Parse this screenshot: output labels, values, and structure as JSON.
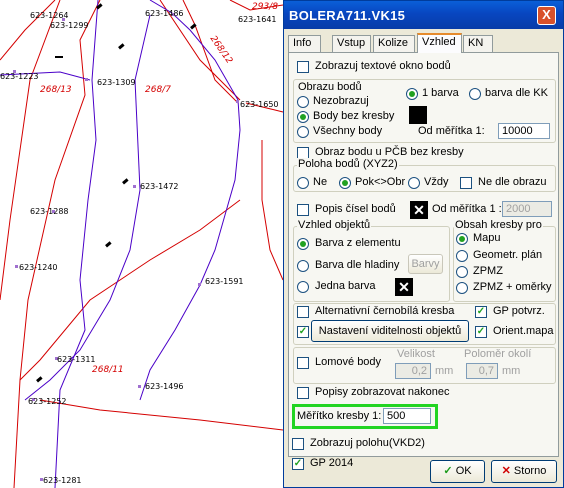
{
  "map": {
    "point_labels": [
      "623-1299",
      "623-1486",
      "623-1641",
      "623-1223",
      "623-1309",
      "623-1650",
      "623-1472",
      "623-1288",
      "623-1240",
      "623-1591",
      "623-1311",
      "623-1252",
      "623-1496",
      "623-1281",
      "623-1264"
    ],
    "parcel_labels": [
      "268/13",
      "268/7",
      "268/12",
      "268/11",
      "293/8"
    ],
    "line_color": "#d40000",
    "route_color": "#4a00c8"
  },
  "dialog": {
    "title": "BOLERA711.VK15",
    "close_glyph": "X",
    "tabs": [
      "Info",
      "Vstup",
      "Kolize",
      "Vzhled",
      "KN"
    ],
    "active_tab": "Vzhled",
    "show_text_window": "Zobrazuj textové okno bodů",
    "points_group": {
      "title": "Obrazu bodů",
      "opt_none": "Nezobrazuj",
      "opt_no_draw": "Body bez kresby",
      "opt_all": "Všechny body",
      "color_one": "1 barva",
      "color_kk": "barva dle KK",
      "scale_label": "Od měřítka 1:",
      "scale_value": "10000"
    },
    "pcb_points": "Obraz bodu u PČB bez kresby",
    "position_group": {
      "title": "Poloha bodů (XYZ2)",
      "opt_no": "Ne",
      "opt_pok": "Pok<>Obr",
      "opt_always": "Vždy",
      "by_image": "Ne dle obrazu"
    },
    "point_numbers": "Popis čísel bodů",
    "numbers_scale_label": "Od měřítka 1 :",
    "numbers_scale_value": "2000",
    "objects_group": {
      "title": "Vzhled objektů",
      "opt_element": "Barva z elementu",
      "opt_level": "Barva dle hladiny",
      "colors_button": "Barvy",
      "opt_one": "Jedna barva"
    },
    "content_group": {
      "title": "Obsah kresby pro",
      "opt_map": "Mapu",
      "opt_geom": "Geometr. plán",
      "opt_zpmz": "ZPMZ",
      "opt_zpmz_scale": "ZPMZ + oměrky"
    },
    "alt_bw": "Alternativní černobílá kresba",
    "gp_confirm": "GP potvrz.",
    "visibility_button": "Nastavení viditelnosti objektů",
    "orient_map": "Orient.mapa",
    "break_points": "Lomové body",
    "size_label": "Velikost",
    "size_value": "0,2",
    "size_unit": "mm",
    "radius_label": "Poloměr okolí",
    "radius_value": "0,7",
    "radius_unit": "mm",
    "labels_last": "Popisy zobrazovat nakonec",
    "scale_label": "Měřítko kresby 1:",
    "scale_value": "500",
    "show_position": "Zobrazuj polohu(VKD2)",
    "gp2014": "GP 2014",
    "ok_label": "OK",
    "cancel_label": "Storno"
  }
}
